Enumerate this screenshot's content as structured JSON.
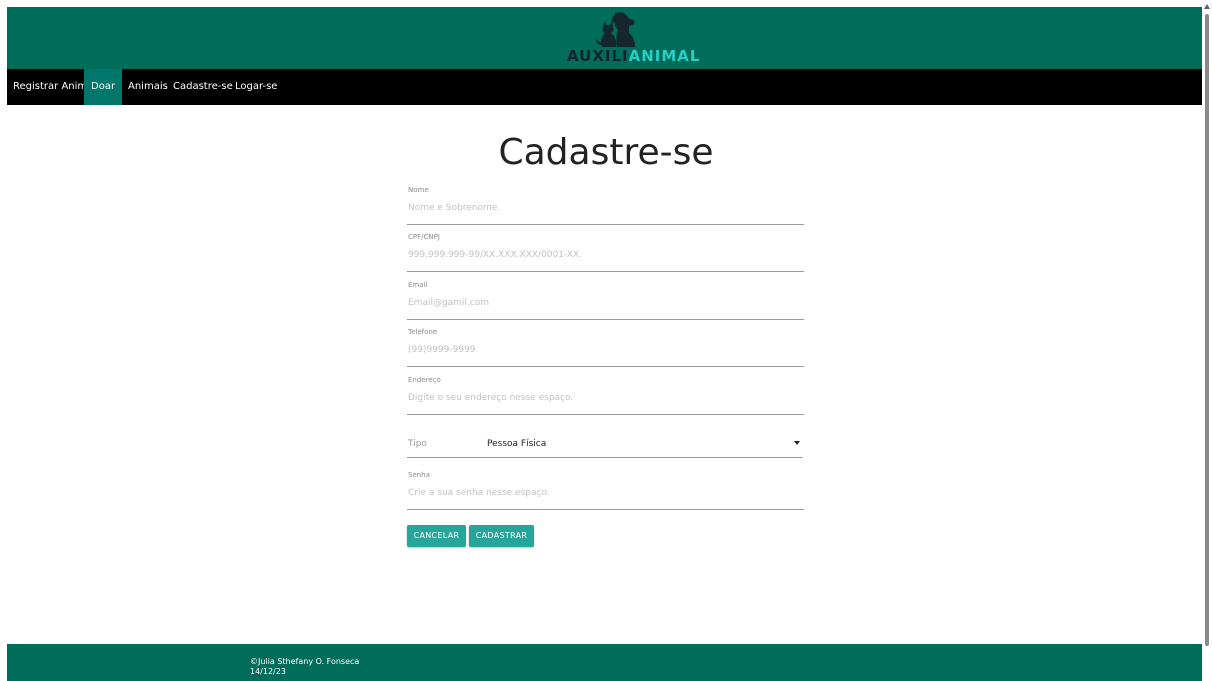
{
  "header": {
    "logo_text_a": "AUXILI",
    "logo_text_b": "ANIMAL",
    "logo_icon": "cat-dog-icon"
  },
  "nav": {
    "items": [
      {
        "label": "Registrar Animal",
        "active": false
      },
      {
        "label": "Doar",
        "active": true
      },
      {
        "label": "Animais",
        "active": false
      },
      {
        "label": "Cadastre-se",
        "active": false
      },
      {
        "label": "Logar-se",
        "active": false
      }
    ]
  },
  "page": {
    "title": "Cadastre-se"
  },
  "form": {
    "nome": {
      "label": "Nome",
      "placeholder": "Nome e Sobrenome.",
      "value": ""
    },
    "cpf": {
      "label": "CPF/CNPJ",
      "placeholder": "999.999.999-99/XX.XXX.XXX/0001-XX.",
      "value": ""
    },
    "email": {
      "label": "Email",
      "placeholder": "Email@gamil.com",
      "value": ""
    },
    "telefone": {
      "label": "Telefone",
      "placeholder": "(99)9999-9999",
      "value": ""
    },
    "endereco": {
      "label": "Endereço",
      "placeholder": "Digite o seu endereço nesse espaço.",
      "value": ""
    },
    "tipo": {
      "label": "Tipo",
      "selected": "Pessoa Física"
    },
    "senha": {
      "label": "Senha",
      "placeholder": "Crie a sua senha nesse espaço.",
      "value": ""
    }
  },
  "buttons": {
    "cancel_label": "CANCELAR",
    "submit_label": "CADASTRAR"
  },
  "footer": {
    "copyright": "©Julia Sthefany O. Fonseca",
    "date": "14/12/23"
  },
  "colors": {
    "header_bg": "#006d5b",
    "nav_bg": "#000000",
    "nav_active": "#00776a",
    "button_bg": "#26a69a",
    "logo_accent": "#27d0c4"
  }
}
